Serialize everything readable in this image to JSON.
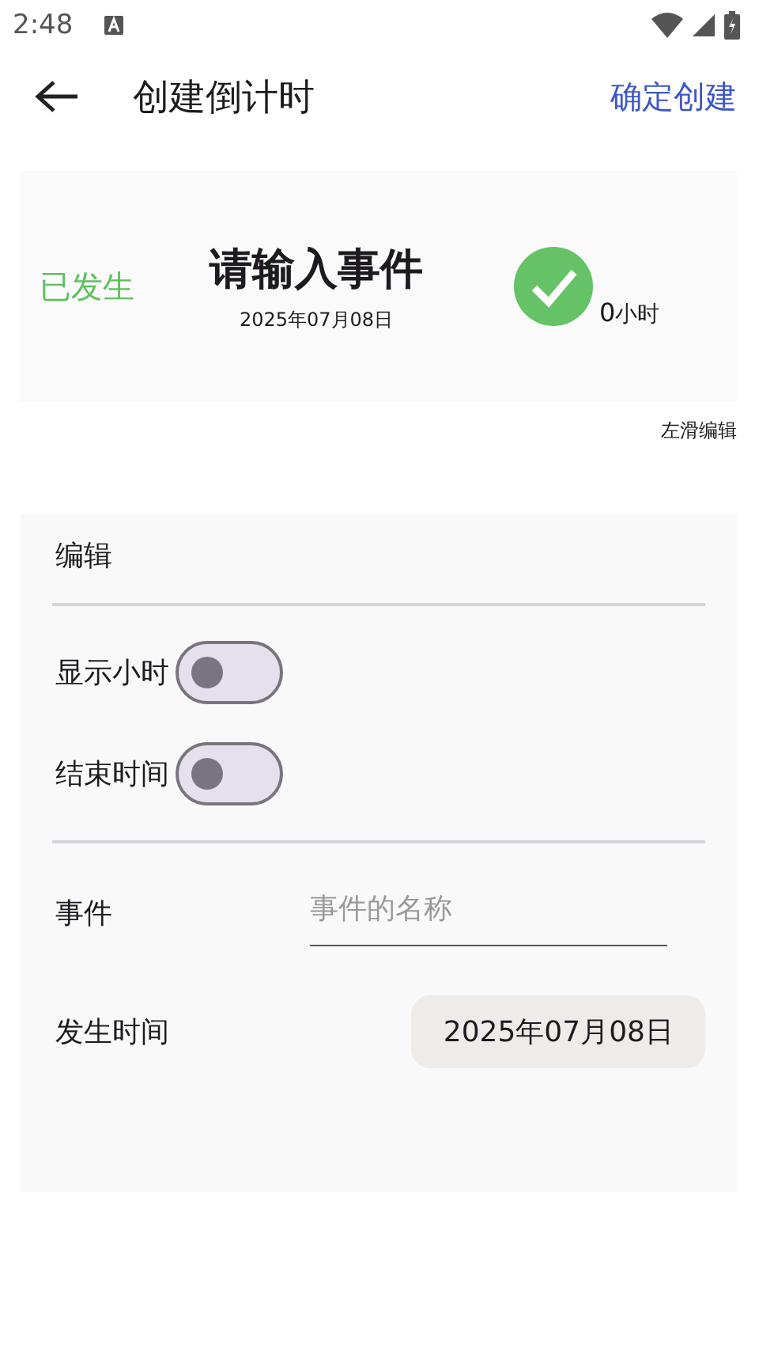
{
  "status_bar": {
    "time": "2:48"
  },
  "header": {
    "title": "创建倒计时",
    "action": "确定创建"
  },
  "preview": {
    "status": "已发生",
    "event": "请输入事件",
    "date": "2025年07月08日",
    "done": true,
    "hours": "0",
    "hours_unit": "小时"
  },
  "swipe_hint": "左滑编辑",
  "editor": {
    "title": "编辑",
    "toggles": [
      {
        "label": "显示小时",
        "checked": false
      },
      {
        "label": "结束时间",
        "checked": false
      }
    ],
    "event": {
      "label": "事件",
      "placeholder": "事件的名称"
    },
    "date": {
      "label": "发生时间",
      "value": "2025年07月08日"
    }
  }
}
